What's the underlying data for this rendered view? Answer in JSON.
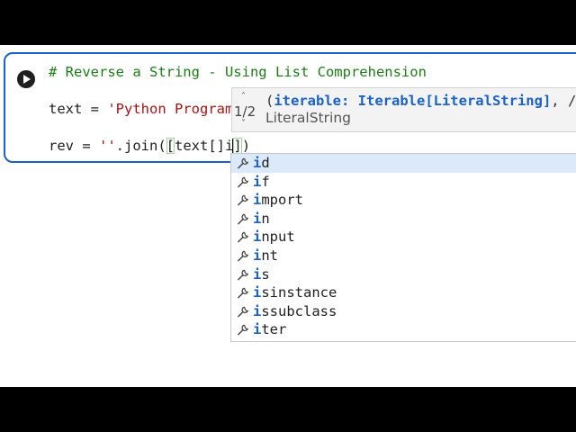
{
  "cell": {
    "comment": "# Reverse a String - Using List Comprehension",
    "line2_prefix": "text = ",
    "line2_string": "'Python Program",
    "line3_prefix": "rev = ",
    "line3_string": "''",
    "line3_mid": ".join(",
    "line3_open_bracket": "[",
    "line3_text": "text[]",
    "line3_typed": "i",
    "line3_close_bracket": "]",
    "line3_close_paren": ")"
  },
  "signature": {
    "counter": "1/2",
    "param_open": "(",
    "param_bold": "iterable: Iterable[LiteralString]",
    "param_rest": ", /",
    "return_type": "LiteralString"
  },
  "suggestions": {
    "prefix": "i",
    "items": [
      {
        "rest": "d",
        "icon": "wrench-icon"
      },
      {
        "rest": "f",
        "icon": "wrench-icon"
      },
      {
        "rest": "mport",
        "icon": "wrench-icon"
      },
      {
        "rest": "n",
        "icon": "wrench-icon"
      },
      {
        "rest": "nput",
        "icon": "wrench-icon"
      },
      {
        "rest": "nt",
        "icon": "wrench-icon"
      },
      {
        "rest": "s",
        "icon": "wrench-icon"
      },
      {
        "rest": "sinstance",
        "icon": "wrench-icon"
      },
      {
        "rest": "ssubclass",
        "icon": "wrench-icon"
      },
      {
        "rest": "ter",
        "icon": "wrench-icon"
      }
    ],
    "selected_index": 0
  },
  "colors": {
    "cell_border": "#1a61c9",
    "comment": "#1e7b18",
    "string": "#a31515",
    "highlight": "#1a61c9",
    "selected_row": "#dbe9fb"
  }
}
